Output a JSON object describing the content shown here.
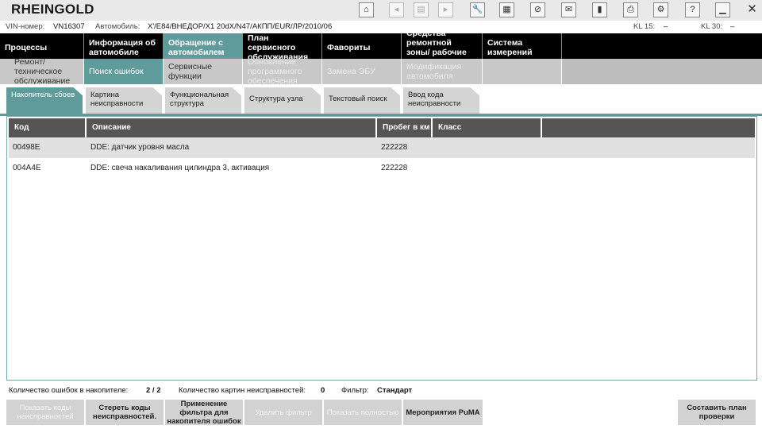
{
  "app": {
    "title": "RHEINGOLD"
  },
  "toolbar": {
    "icons": [
      "home-icon",
      "arrow-left-icon",
      "documents-icon",
      "arrow-right-icon",
      "wrench-icon",
      "vehicle-data-icon",
      "no-connection-icon",
      "mail-icon",
      "battery-icon",
      "print-icon",
      "user-settings-icon",
      "help-icon",
      "minimize-icon",
      "close-icon"
    ],
    "glyphs": [
      "⌂",
      "◂",
      "▤",
      "▸",
      "🔧",
      "▦",
      "⊘",
      "✉",
      "▮",
      "⎙",
      "⚙",
      "?",
      "▁",
      "✕"
    ]
  },
  "vehicle": {
    "vin_label": "VIN-номер:",
    "vin_value": "VN16307",
    "car_label": "Автомобиль:",
    "car_value": "X'/E84/ВНЕДОР/X1 20dX/N47/АКПП/EUR/ЛР/2010/06",
    "kl15_label": "KL 15:",
    "kl15_value": "–",
    "kl30_label": "KL 30:",
    "kl30_value": "–"
  },
  "main_nav": [
    {
      "label": "Процессы"
    },
    {
      "label": "Информация об автомобиле"
    },
    {
      "label": "Обращение с автомобилем"
    },
    {
      "label": "План сервисного обслуживания"
    },
    {
      "label": "Фавориты"
    },
    {
      "label": "Средства ремонтной зоны/ рабочие жидкости"
    },
    {
      "label": "Система измерений"
    }
  ],
  "sub_nav": [
    {
      "label": "Ремонт/ техническое обслуживание"
    },
    {
      "label": "Поиск ошибок"
    },
    {
      "label": "Сервисные функции"
    },
    {
      "label": "Обновление программного обеспечения"
    },
    {
      "label": "Замена ЭБУ"
    },
    {
      "label": "Модификация автомобиля"
    }
  ],
  "function_tabs": [
    {
      "label": "Накопитель сбоев"
    },
    {
      "label": "Картина неисправности"
    },
    {
      "label": "Функциональная структура"
    },
    {
      "label": "Структура узла"
    },
    {
      "label": "Текстовый поиск"
    },
    {
      "label": "Ввод кода неисправности"
    }
  ],
  "table": {
    "columns": [
      "Код",
      "Описание",
      "Пробег в км",
      "Класс"
    ],
    "rows": [
      {
        "code": "00498E",
        "description": "DDE: датчик уровня масла",
        "mileage": "222228",
        "class": ""
      },
      {
        "code": "004A4E",
        "description": "DDE: свеча накаливания цилиндра 3, активация",
        "mileage": "222228",
        "class": ""
      }
    ]
  },
  "status": {
    "fault_count_label": "Количество ошибок в накопителе:",
    "fault_count_value": "2 / 2",
    "pattern_count_label": "Количество картин неисправностей:",
    "pattern_count_value": "0",
    "filter_label": "Фильтр:",
    "filter_value": "Стандарт"
  },
  "buttons": {
    "show_codes": "Показать коды неисправностей",
    "clear_codes": "Стереть коды неисправностей.",
    "apply_filter": "Применение фильтра для накопителя ошибок",
    "remove_filter": "Удалить фильтр",
    "show_all": "Показать полностью",
    "puma": "Мероприятия PuMA",
    "test_plan": "Составить план проверки"
  }
}
